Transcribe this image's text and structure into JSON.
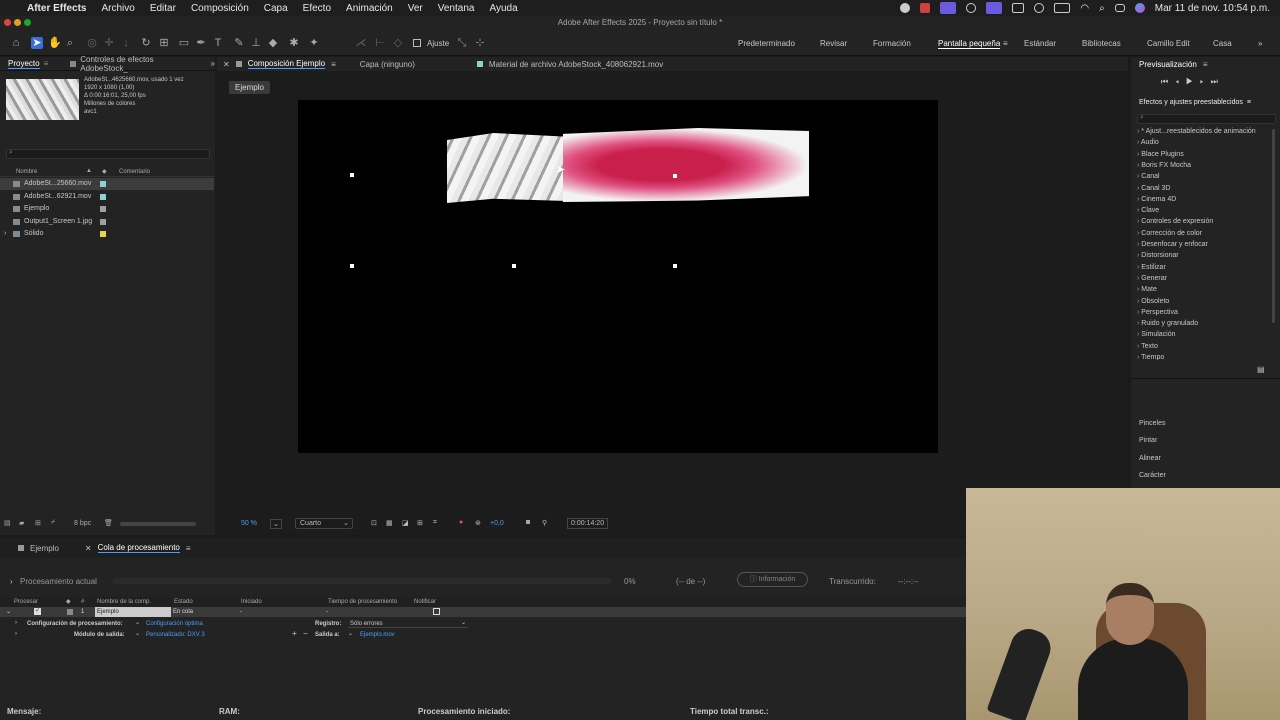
{
  "menubar": {
    "app": "After Effects",
    "items": [
      "Archivo",
      "Editar",
      "Composición",
      "Capa",
      "Efecto",
      "Animación",
      "Ver",
      "Ventana",
      "Ayuda"
    ],
    "datetime": "Mar 11 de nov.  10:54 p.m."
  },
  "window": {
    "title": "Adobe After Effects 2025 - Proyecto sin título *"
  },
  "toolbar": {
    "snap_label": "Ajuste",
    "workspaces": [
      "Predeterminado",
      "Revisar",
      "Formación",
      "Pantalla pequeña",
      "Estándar",
      "Bibliotecas",
      "Camillo Edit",
      "Casa"
    ],
    "active_workspace": "Pantalla pequeña"
  },
  "project": {
    "tab": "Proyecto",
    "effects_tab": "Controles de efectos AdobeStock_",
    "file_name": "AdobeSt...4625660.mov",
    "used": ", usado 1 vez",
    "res": "1920 x 1080 (1,00)",
    "duration": "Δ 0:00:16:01, 25,00 fps",
    "colors": "Millones de colores",
    "codec": "avc1",
    "search_placeholder": "",
    "col_name": "Nombre",
    "col_comment": "Comentario",
    "items": [
      {
        "name": "AdobeSt...25660.mov",
        "color": "#8fd0d0",
        "selected": true
      },
      {
        "name": "AdobeSt...62921.mov",
        "color": "#8fd0d0",
        "selected": false
      },
      {
        "name": "Ejemplo",
        "color": "#a0a0a0",
        "selected": false
      },
      {
        "name": "Output1_Screen 1.jpg",
        "color": "#a0a0a0",
        "selected": false
      },
      {
        "name": "Sólido",
        "color": "#e8d34a",
        "selected": false
      }
    ],
    "bpc": "8 bpc"
  },
  "viewer": {
    "comp_tab": "Composición Ejemplo",
    "layer_tab": "Capa (ninguno)",
    "footage_tab": "Material de archivo AdobeStock_408062921.mov",
    "comp_chip": "Ejemplo",
    "zoom": "50 %",
    "resolution": "Cuarto",
    "exposure": "+0,0",
    "timecode": "0:00:14:20"
  },
  "rightpanel": {
    "preview": "Previsualización",
    "effects_title": "Efectos y ajustes preestablecidos",
    "search_placeholder": "",
    "categories": [
      "* Ajust...reestablecidos de animación",
      "Audio",
      "Blace Plugins",
      "Boris FX Mocha",
      "Canal",
      "Canal 3D",
      "Cinema 4D",
      "Clave",
      "Controles de expresión",
      "Corrección de color",
      "Desenfocar y enfocar",
      "Distorsionar",
      "Estilizar",
      "Generar",
      "Mate",
      "Obsoleto",
      "Perspectiva",
      "Ruido y granulado",
      "Simulación",
      "Texto",
      "Tiempo"
    ],
    "panels": [
      "Pinceles",
      "Pintar",
      "Alinear",
      "Carácter"
    ]
  },
  "render": {
    "tab_ejemplo": "Ejemplo",
    "tab_queue": "Cola de procesamiento",
    "current": "Procesamiento actual",
    "percent": "0%",
    "remaining": "(-- de --)",
    "info_button": "Información",
    "elapsed_label": "Transcurrido:",
    "elapsed": "--:--:--",
    "headers": [
      "Procesar",
      "#",
      "Nombre de la comp.",
      "Estado",
      "Iniciado",
      "Tiempo de procesamiento",
      "Notificar"
    ],
    "row": {
      "num": "1",
      "name": "Ejemplo",
      "status": "En cola",
      "started": "-",
      "time": "-"
    },
    "settings_label": "Configuración de procesamiento:",
    "settings_value": "Configuración óptima",
    "module_label": "Módulo de salida:",
    "module_value": "Personalizado: DXV 3",
    "log_label": "Registro:",
    "log_value": "Sólo errores",
    "output_label": "Salida a:",
    "output_value": "Ejemplo.mov"
  },
  "status": {
    "message": "Mensaje:",
    "ram": "RAM:",
    "started": "Procesamiento iniciado:",
    "total": "Tiempo total transc.:"
  }
}
